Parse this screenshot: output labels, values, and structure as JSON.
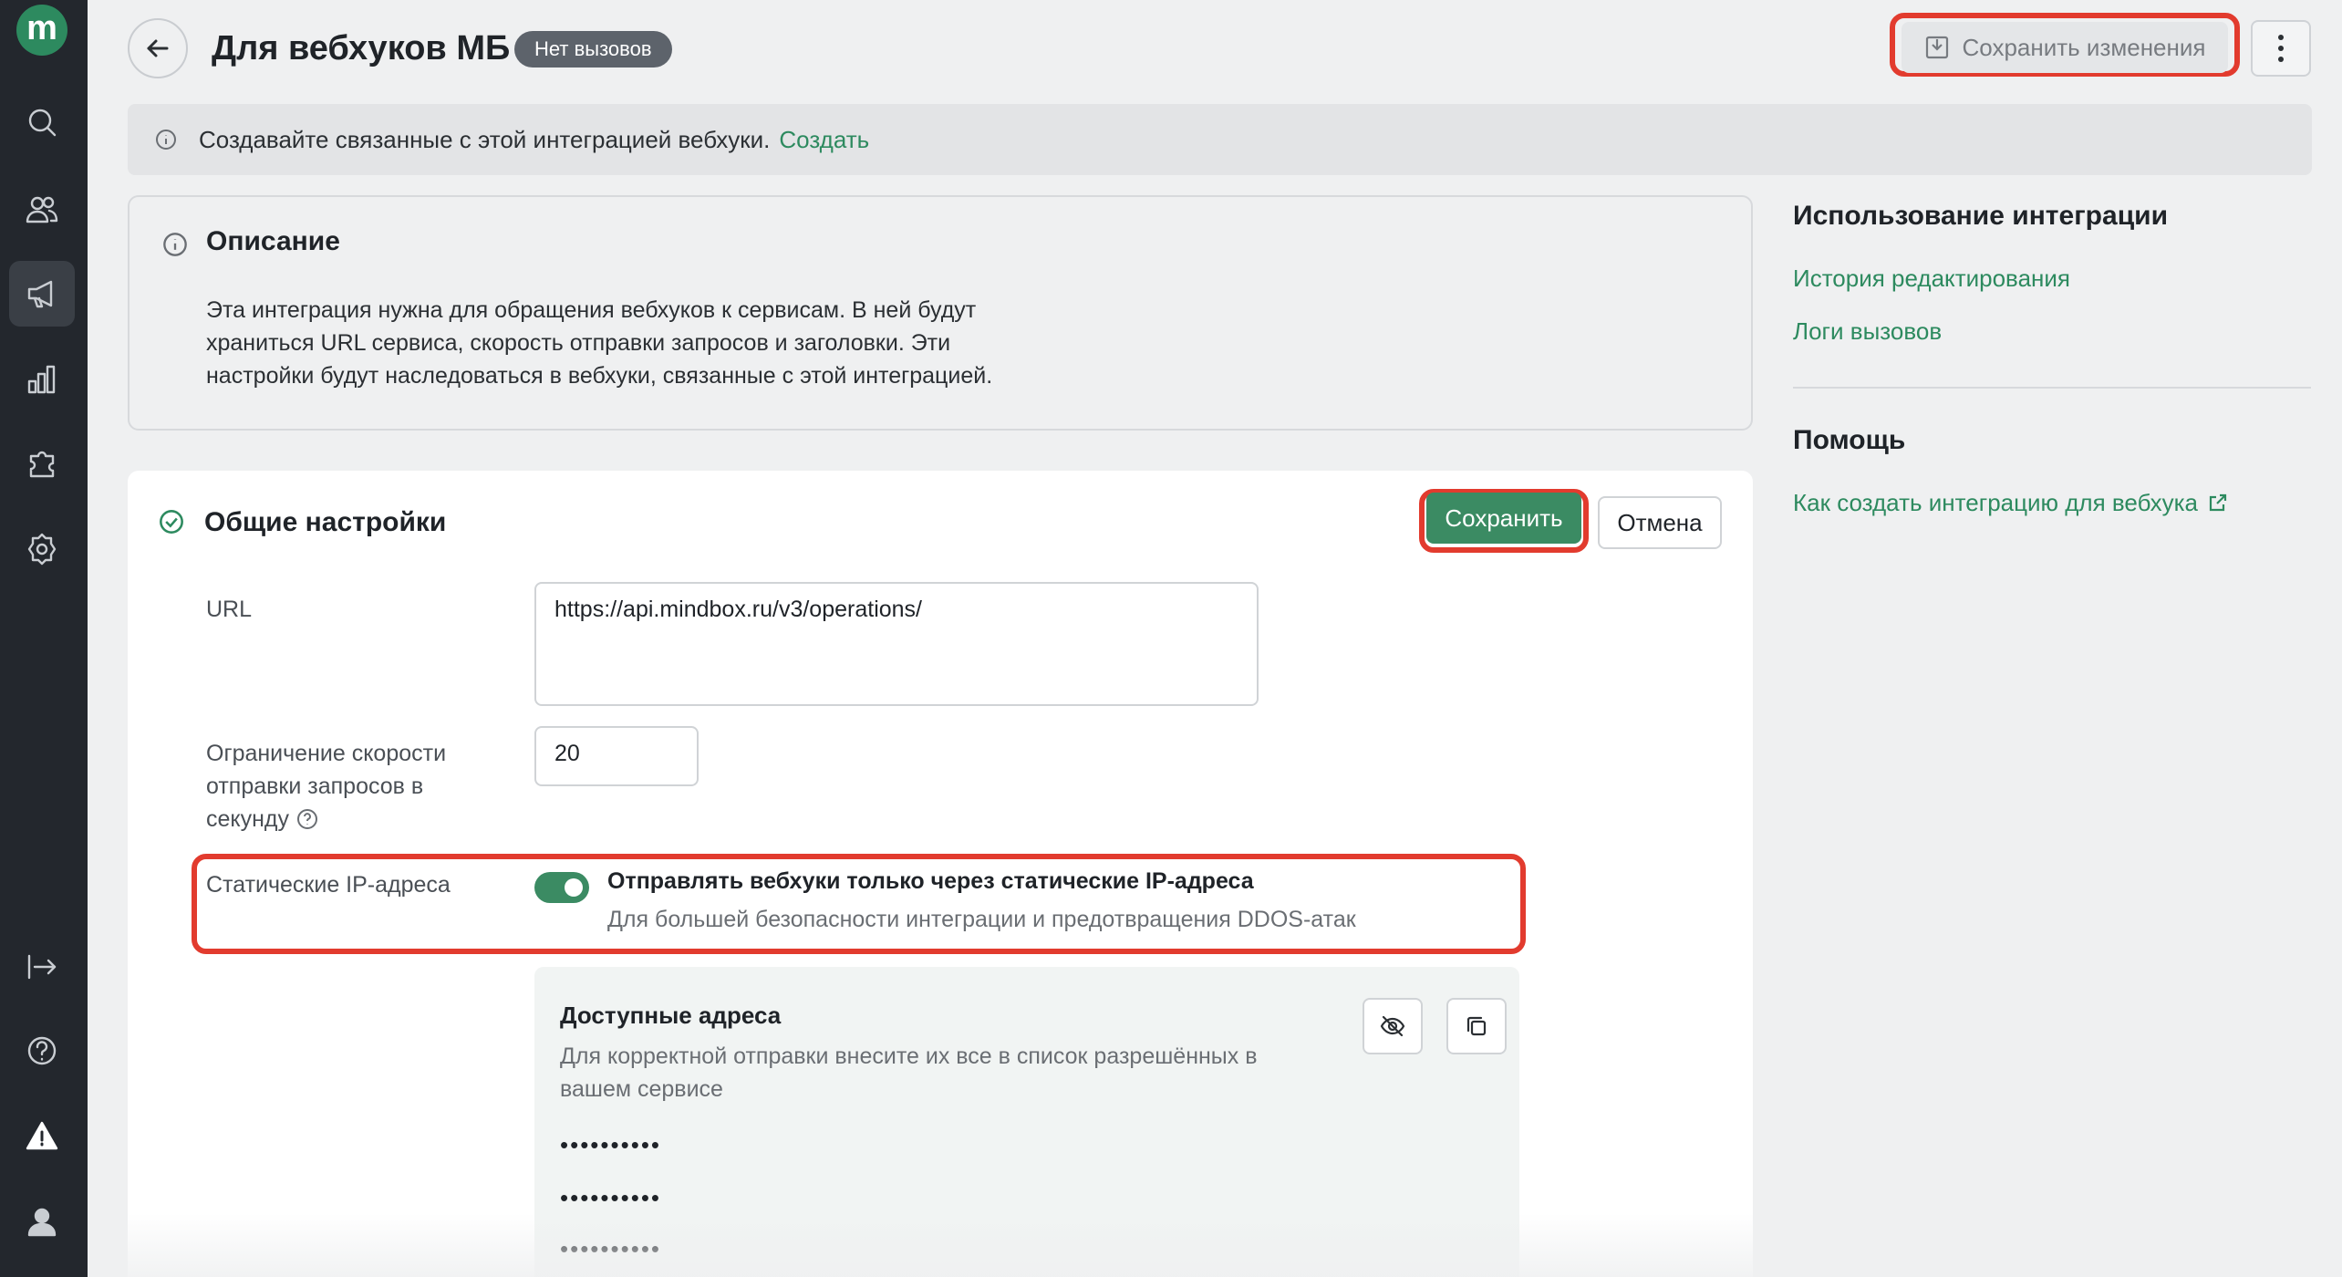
{
  "app": {
    "logo_letter": "m"
  },
  "header": {
    "title": "Для вебхуков МБ",
    "status_badge": "Нет вызовов",
    "save_changes_label": "Сохранить изменения"
  },
  "banner": {
    "text": "Создавайте связанные с этой интеграцией вебхуки.",
    "link": "Создать"
  },
  "description": {
    "title": "Описание",
    "line1": "Эта интеграция нужна для обращения вебхуков к сервисам. В ней будут",
    "line2": "храниться URL сервиса, скорость отправки запросов и заголовки. Эти",
    "line3": "настройки будут наследоваться в вебхуки, связанные с этой интеграцией."
  },
  "settings": {
    "title": "Общие настройки",
    "save_label": "Сохранить",
    "cancel_label": "Отмена",
    "url_label": "URL",
    "url_value": "https://api.mindbox.ru/v3/operations/",
    "rate_label_line1": "Ограничение скорости",
    "rate_label_line2": "отправки запросов в",
    "rate_label_line3": "секунду",
    "rate_value": "20",
    "static_ip_label": "Статические IP-адреса",
    "static_ip_toggle_on": true,
    "static_ip_title": "Отправлять вебхуки только через статические IP-адреса",
    "static_ip_sub": "Для большей безопасности интеграции и предотвращения DDOS-атак",
    "addresses": {
      "title": "Доступные адреса",
      "sub_line1": "Для корректной отправки внесите их все в список разрешённых в",
      "sub_line2": "вашем сервисе",
      "items": [
        "••••••••••",
        "••••••••••",
        "••••••••••"
      ]
    }
  },
  "right_panel": {
    "usage_title": "Использование интеграции",
    "history_link": "История редактирования",
    "logs_link": "Логи вызовов",
    "help_title": "Помощь",
    "help_link": "Как создать интеграцию для вебхука"
  },
  "colors": {
    "accent": "#2d8a5f",
    "highlight": "#e23b2e",
    "sidebar": "#23272d"
  }
}
